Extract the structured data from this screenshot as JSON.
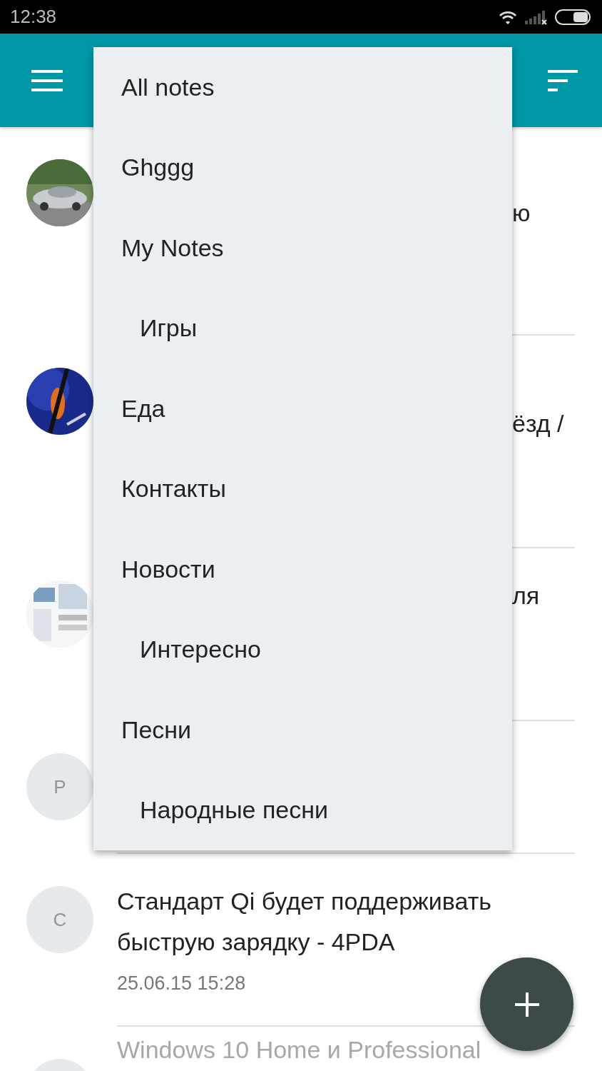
{
  "status_bar": {
    "time": "12:38"
  },
  "notes": [
    {
      "kind": "covered",
      "fragment": "ю"
    },
    {
      "kind": "covered",
      "fragment": "ёзд /"
    },
    {
      "kind": "covered",
      "fragment": "ля"
    },
    {
      "kind": "covered",
      "avatar": {
        "kind": "letter",
        "letter": "P"
      }
    },
    {
      "kind": "full",
      "avatar": {
        "kind": "letter",
        "letter": "C"
      },
      "title": "Стандарт Qi будет поддерживать быструю зарядку - 4PDA",
      "date": "25.06.15 15:28"
    },
    {
      "kind": "cut",
      "avatar": {
        "kind": "blank"
      },
      "title": "Windows 10 Home и Professional"
    }
  ],
  "menu": {
    "items": [
      {
        "label": "All notes"
      },
      {
        "label": "Ghggg"
      },
      {
        "label": "My Notes",
        "children": [
          {
            "label": "Игры"
          }
        ]
      },
      {
        "label": "Еда"
      },
      {
        "label": "Контакты"
      },
      {
        "label": "Новости",
        "children": [
          {
            "label": "Интересно"
          }
        ]
      },
      {
        "label": "Песни",
        "children": [
          {
            "label": "Народные песни"
          }
        ]
      }
    ]
  }
}
